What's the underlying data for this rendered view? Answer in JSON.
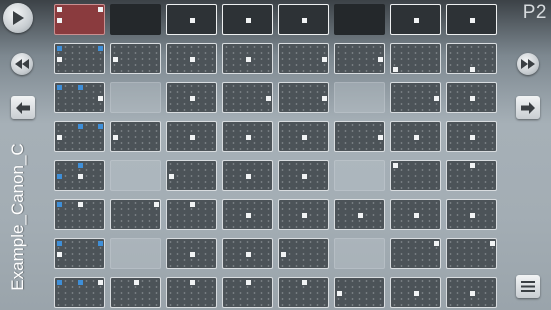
{
  "app": {
    "project_title": "Example_Canon_C",
    "page_label": "P2"
  },
  "controls": {
    "play_icon": "play-icon",
    "rewind_icon": "rewind-icon",
    "fast_forward_icon": "fast-forward-icon",
    "prev_page_icon": "arrow-left-icon",
    "next_page_icon": "arrow-right-icon",
    "menu_icon": "menu-icon"
  },
  "colors": {
    "active_cell": "#8a3b3e",
    "pattern_cell": "#4c5358",
    "note_white": "#f1f3f4",
    "note_blue": "#3f8fd8"
  },
  "grid": {
    "columns": 8,
    "rows": 8,
    "cells": [
      [
        {
          "t": "active",
          "n": [
            [
              "w",
              0,
              0
            ],
            [
              "w",
              0,
              1
            ],
            [
              "w",
              2,
              0
            ]
          ]
        },
        {
          "t": "emptydark"
        },
        {
          "t": "header",
          "n": [
            [
              "w",
              1,
              1
            ]
          ]
        },
        {
          "t": "header",
          "n": [
            [
              "w",
              1,
              1
            ]
          ]
        },
        {
          "t": "header",
          "n": [
            [
              "w",
              1,
              1
            ]
          ]
        },
        {
          "t": "emptydark"
        },
        {
          "t": "header",
          "n": [
            [
              "w",
              1,
              1
            ]
          ]
        },
        {
          "t": "header",
          "n": [
            [
              "w",
              1,
              1
            ]
          ]
        }
      ],
      [
        {
          "t": "pattern",
          "n": [
            [
              "b",
              0,
              0
            ],
            [
              "b",
              2,
              0
            ],
            [
              "w",
              0,
              1
            ]
          ]
        },
        {
          "t": "pattern",
          "n": [
            [
              "w",
              0,
              1
            ]
          ]
        },
        {
          "t": "pattern",
          "n": [
            [
              "w",
              1,
              1
            ]
          ]
        },
        {
          "t": "pattern",
          "n": [
            [
              "w",
              1,
              1
            ]
          ]
        },
        {
          "t": "pattern",
          "n": [
            [
              "w",
              2,
              1
            ]
          ]
        },
        {
          "t": "pattern",
          "n": [
            [
              "w",
              2,
              1
            ]
          ]
        },
        {
          "t": "pattern",
          "n": [
            [
              "w",
              0,
              2
            ]
          ]
        },
        {
          "t": "pattern",
          "n": [
            [
              "w",
              1,
              2
            ]
          ]
        }
      ],
      [
        {
          "t": "pattern",
          "n": [
            [
              "b",
              0,
              0
            ],
            [
              "b",
              1,
              0
            ],
            [
              "w",
              2,
              1
            ]
          ]
        },
        {
          "t": "empty"
        },
        {
          "t": "pattern",
          "n": [
            [
              "w",
              1,
              1
            ]
          ]
        },
        {
          "t": "pattern",
          "n": [
            [
              "w",
              2,
              1
            ]
          ]
        },
        {
          "t": "pattern",
          "n": [
            [
              "w",
              2,
              1
            ]
          ]
        },
        {
          "t": "empty"
        },
        {
          "t": "pattern",
          "n": [
            [
              "w",
              2,
              1
            ]
          ]
        },
        {
          "t": "pattern",
          "n": [
            [
              "w",
              1,
              1
            ]
          ]
        }
      ],
      [
        {
          "t": "pattern",
          "n": [
            [
              "b",
              1,
              0
            ],
            [
              "b",
              2,
              0
            ],
            [
              "w",
              0,
              1
            ]
          ]
        },
        {
          "t": "pattern",
          "n": [
            [
              "w",
              0,
              1
            ]
          ]
        },
        {
          "t": "pattern",
          "n": [
            [
              "w",
              1,
              1
            ]
          ]
        },
        {
          "t": "pattern",
          "n": [
            [
              "w",
              1,
              1
            ]
          ]
        },
        {
          "t": "pattern",
          "n": [
            [
              "w",
              1,
              1
            ]
          ]
        },
        {
          "t": "pattern",
          "n": [
            [
              "w",
              2,
              1
            ]
          ]
        },
        {
          "t": "pattern",
          "n": [
            [
              "w",
              1,
              1
            ]
          ]
        },
        {
          "t": "pattern",
          "n": [
            [
              "w",
              1,
              1
            ]
          ]
        }
      ],
      [
        {
          "t": "pattern",
          "n": [
            [
              "b",
              1,
              0
            ],
            [
              "b",
              0,
              1
            ],
            [
              "w",
              1,
              1
            ]
          ]
        },
        {
          "t": "empty"
        },
        {
          "t": "pattern",
          "n": [
            [
              "w",
              0,
              1
            ]
          ]
        },
        {
          "t": "pattern",
          "n": [
            [
              "w",
              1,
              1
            ]
          ]
        },
        {
          "t": "pattern",
          "n": [
            [
              "w",
              1,
              1
            ]
          ]
        },
        {
          "t": "empty"
        },
        {
          "t": "pattern",
          "n": [
            [
              "w",
              0,
              0
            ]
          ]
        },
        {
          "t": "pattern",
          "n": [
            [
              "w",
              1,
              0
            ]
          ]
        }
      ],
      [
        {
          "t": "pattern",
          "n": [
            [
              "b",
              0,
              0
            ],
            [
              "w",
              1,
              0
            ]
          ]
        },
        {
          "t": "pattern",
          "n": [
            [
              "w",
              2,
              0
            ]
          ]
        },
        {
          "t": "pattern",
          "n": [
            [
              "w",
              1,
              0
            ]
          ]
        },
        {
          "t": "pattern",
          "n": [
            [
              "w",
              1,
              1
            ]
          ]
        },
        {
          "t": "pattern",
          "n": [
            [
              "w",
              1,
              1
            ]
          ]
        },
        {
          "t": "pattern",
          "n": [
            [
              "w",
              1,
              1
            ]
          ]
        },
        {
          "t": "pattern",
          "n": [
            [
              "w",
              1,
              1
            ]
          ]
        },
        {
          "t": "pattern",
          "n": [
            [
              "w",
              1,
              1
            ]
          ]
        }
      ],
      [
        {
          "t": "pattern",
          "n": [
            [
              "b",
              0,
              0
            ],
            [
              "b",
              2,
              0
            ],
            [
              "w",
              0,
              1
            ]
          ]
        },
        {
          "t": "empty"
        },
        {
          "t": "pattern",
          "n": [
            [
              "w",
              1,
              1
            ]
          ]
        },
        {
          "t": "pattern",
          "n": [
            [
              "w",
              1,
              1
            ]
          ]
        },
        {
          "t": "pattern",
          "n": [
            [
              "w",
              0,
              1
            ]
          ]
        },
        {
          "t": "empty"
        },
        {
          "t": "pattern",
          "n": [
            [
              "w",
              2,
              0
            ]
          ]
        },
        {
          "t": "pattern",
          "n": [
            [
              "w",
              2,
              0
            ]
          ]
        }
      ],
      [
        {
          "t": "pattern",
          "n": [
            [
              "b",
              0,
              0
            ],
            [
              "b",
              1,
              0
            ],
            [
              "w",
              2,
              0
            ]
          ]
        },
        {
          "t": "pattern",
          "n": [
            [
              "w",
              1,
              0
            ]
          ]
        },
        {
          "t": "pattern",
          "n": [
            [
              "w",
              1,
              0
            ]
          ]
        },
        {
          "t": "pattern",
          "n": [
            [
              "w",
              1,
              0
            ]
          ]
        },
        {
          "t": "pattern",
          "n": [
            [
              "w",
              1,
              0
            ]
          ]
        },
        {
          "t": "pattern",
          "n": [
            [
              "w",
              0,
              1
            ]
          ]
        },
        {
          "t": "pattern",
          "n": [
            [
              "w",
              1,
              1
            ]
          ]
        },
        {
          "t": "pattern",
          "n": [
            [
              "w",
              1,
              1
            ]
          ]
        }
      ]
    ]
  }
}
